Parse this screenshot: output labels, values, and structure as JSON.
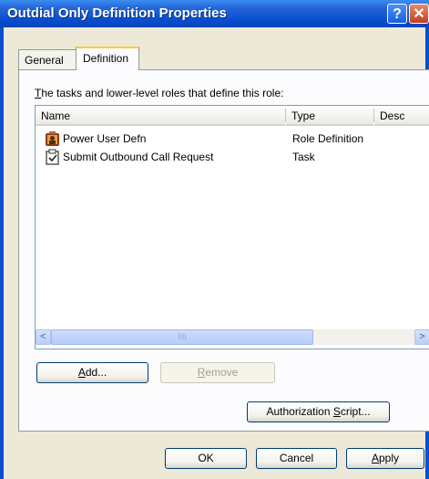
{
  "window": {
    "title": "Outdial Only Definition Properties",
    "help_glyph": "?",
    "close_glyph": "✕"
  },
  "tabs": [
    {
      "label": "General",
      "active": false
    },
    {
      "label": "Definition",
      "active": true
    }
  ],
  "definition": {
    "description_underlined": "T",
    "description_rest": "he tasks and lower-level roles that define this role:",
    "columns": [
      "Name",
      "Type",
      "Desc"
    ],
    "rows": [
      {
        "name": "Power User Defn",
        "type": "Role Definition",
        "icon": "role-definition-icon"
      },
      {
        "name": "Submit Outbound Call Request",
        "type": "Task",
        "icon": "task-icon"
      }
    ],
    "scroll_left": "<",
    "scroll_right": ">",
    "thumb_grip": "IIII"
  },
  "buttons": {
    "add_u": "A",
    "add_rest": "dd...",
    "remove_u": "R",
    "remove_rest": "emove",
    "authscript_pre": "Authorization ",
    "authscript_u": "S",
    "authscript_rest": "cript...",
    "ok": "OK",
    "cancel": "Cancel",
    "apply_u": "A",
    "apply_rest": "pply"
  },
  "colors": {
    "titlebar": "#0a4fd0",
    "dialog_face": "#ece9d8",
    "active_tab_accent": "#ffc83c"
  }
}
